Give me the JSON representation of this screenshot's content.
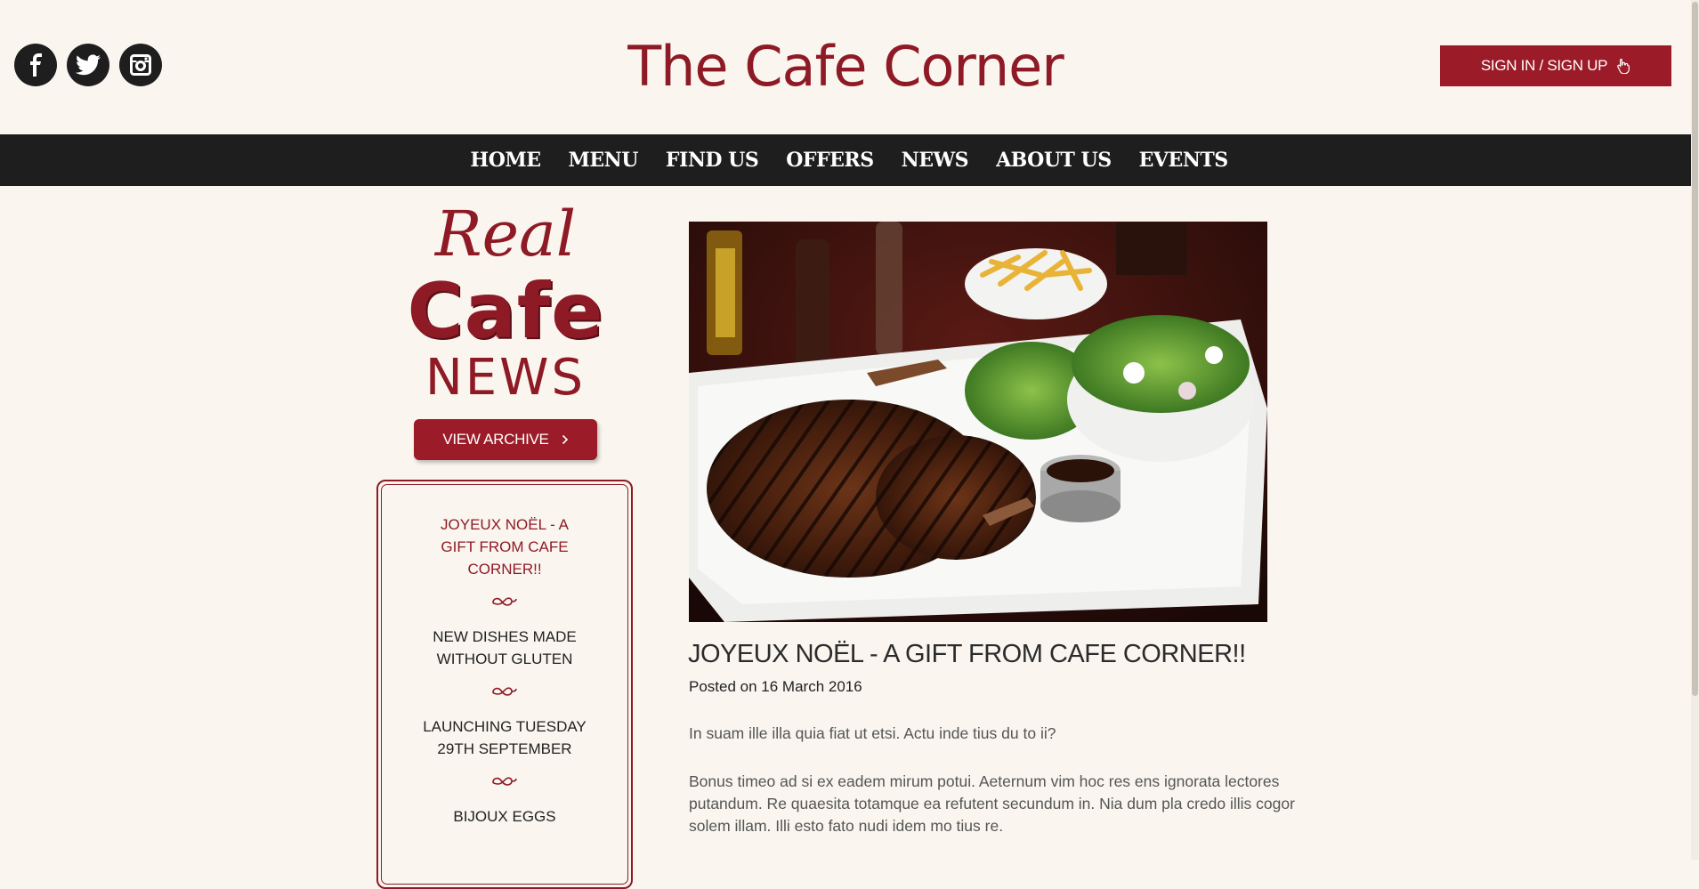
{
  "header": {
    "brand": "The Cafe Corner",
    "signin_label": "SIGN IN / SIGN UP",
    "social": [
      "facebook-icon",
      "twitter-icon",
      "instagram-icon"
    ]
  },
  "nav": {
    "items": [
      "HOME",
      "MENU",
      "FIND US",
      "OFFERS",
      "NEWS",
      "ABOUT US",
      "EVENTS"
    ]
  },
  "sidebar": {
    "logo_real": "Real",
    "logo_cafe": "Cafe",
    "logo_news": "NEWS",
    "archive_label": "VIEW ARCHIVE",
    "news": [
      "JOYEUX NOËL - A GIFT FROM CAFE CORNER!!",
      "NEW DISHES MADE WITHOUT GLUTEN",
      "LAUNCHING TUESDAY 29TH SEPTEMBER",
      "BIJOUX EGGS"
    ]
  },
  "article": {
    "title": "JOYEUX NOËL - A GIFT FROM CAFE CORNER!!",
    "posted": "Posted on 16 March 2016",
    "paragraphs": [
      "In suam ille illa quia fiat ut etsi. Actu inde tius du to ii?",
      "Bonus timeo ad si ex eadem mirum potui. Aeternum vim hoc res ens ignorata lectores putandum. Re quaesita totamque ea refutent secundum in. Nia dum pla credo illis cogor solem illam. Illi esto fato nudi idem mo tius re."
    ]
  },
  "colors": {
    "brand": "#8e1a25",
    "button": "#9b1b28",
    "nav_bg": "#1e1e1e",
    "page_bg": "#faf6ef"
  }
}
